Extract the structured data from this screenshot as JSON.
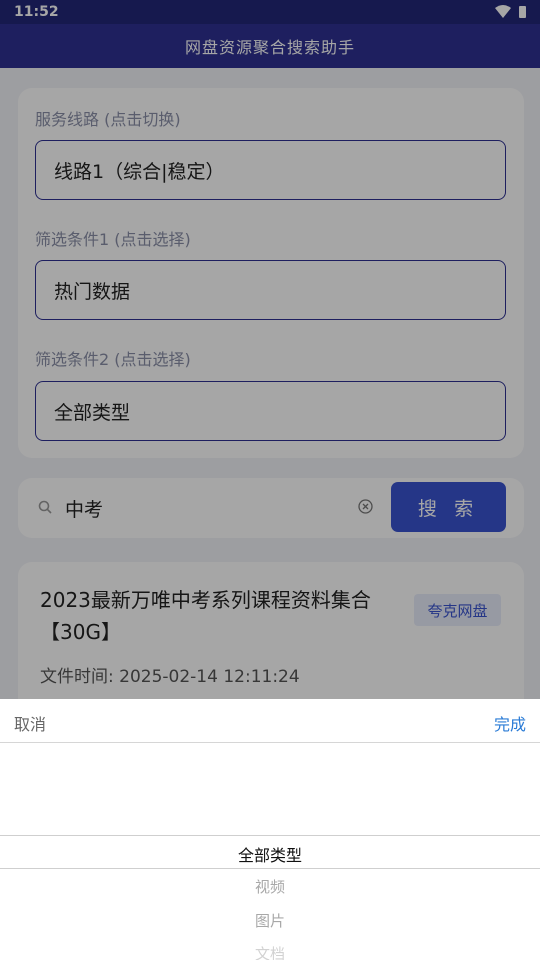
{
  "status_bar": {
    "time": "11:52"
  },
  "app_bar": {
    "title": "网盘资源聚合搜索助手"
  },
  "filters": {
    "service_label": "服务线路 (点击切换)",
    "service_value": "线路1（综合|稳定）",
    "filter1_label": "筛选条件1 (点击选择)",
    "filter1_value": "热门数据",
    "filter2_label": "筛选条件2 (点击选择)",
    "filter2_value": "全部类型"
  },
  "search": {
    "query": "中考",
    "button_label": "搜 索"
  },
  "result": {
    "title": "2023最新万唯中考系列课程资料集合【30G】",
    "source": "夸克网盘",
    "time": "文件时间: 2025-02-14 12:11:24"
  },
  "picker": {
    "cancel_label": "取消",
    "done_label": "完成",
    "options": [
      "全部类型",
      "视频",
      "图片",
      "文档"
    ],
    "selected": "全部类型"
  }
}
